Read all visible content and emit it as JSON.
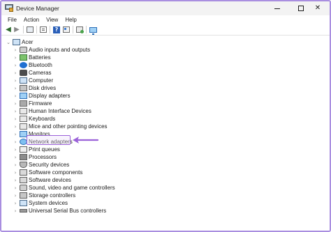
{
  "window": {
    "title": "Device Manager",
    "minimize_glyph": "—",
    "close_glyph": "✕"
  },
  "menu": {
    "items": [
      "File",
      "Action",
      "View",
      "Help"
    ]
  },
  "toolbar": {
    "back_icon": "back-arrow-icon",
    "forward_icon": "forward-arrow-icon",
    "help_glyph": "?"
  },
  "tree": {
    "root": {
      "label": "Acer",
      "expanded": true
    },
    "categories": [
      {
        "label": "Audio inputs and outputs",
        "icon": "speaker-icon"
      },
      {
        "label": "Batteries",
        "icon": "battery-icon"
      },
      {
        "label": "Bluetooth",
        "icon": "bluetooth-icon"
      },
      {
        "label": "Cameras",
        "icon": "camera-icon"
      },
      {
        "label": "Computer",
        "icon": "computer-icon"
      },
      {
        "label": "Disk drives",
        "icon": "disk-drive-icon"
      },
      {
        "label": "Display adapters",
        "icon": "display-adapter-icon"
      },
      {
        "label": "Firmware",
        "icon": "firmware-icon"
      },
      {
        "label": "Human Interface Devices",
        "icon": "hid-icon"
      },
      {
        "label": "Keyboards",
        "icon": "keyboard-icon"
      },
      {
        "label": "Mice and other pointing devices",
        "icon": "mouse-icon"
      },
      {
        "label": "Monitors",
        "icon": "monitor-icon"
      },
      {
        "label": "Network adapters",
        "icon": "network-adapter-icon",
        "highlighted": true
      },
      {
        "label": "Print queues",
        "icon": "printer-icon"
      },
      {
        "label": "Processors",
        "icon": "processor-icon"
      },
      {
        "label": "Security devices",
        "icon": "security-device-icon"
      },
      {
        "label": "Software components",
        "icon": "software-component-icon"
      },
      {
        "label": "Software devices",
        "icon": "software-device-icon"
      },
      {
        "label": "Sound, video and game controllers",
        "icon": "sound-controller-icon"
      },
      {
        "label": "Storage controllers",
        "icon": "storage-controller-icon"
      },
      {
        "label": "System devices",
        "icon": "system-device-icon"
      },
      {
        "label": "Universal Serial Bus controllers",
        "icon": "usb-icon"
      }
    ]
  },
  "colors": {
    "accent_highlight": "#9b62d9",
    "window_border": "#a98ee0"
  }
}
